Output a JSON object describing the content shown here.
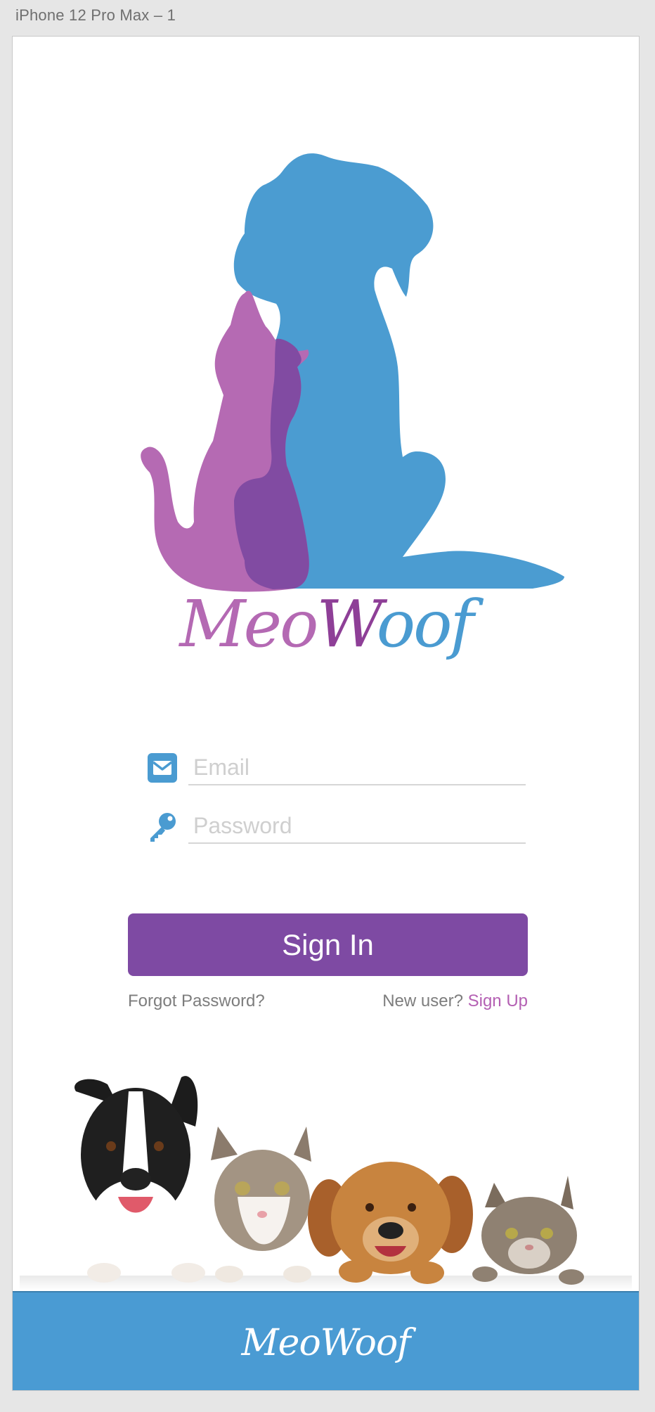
{
  "window": {
    "artboard_title": "iPhone 12 Pro Max – 1"
  },
  "brand": {
    "part1": "Meo",
    "part2": "W",
    "part3": "oof"
  },
  "form": {
    "email_placeholder": "Email",
    "password_placeholder": "Password",
    "sign_in_label": "Sign In"
  },
  "links": {
    "forgot_password": "Forgot Password?",
    "new_user": "New user?",
    "sign_up": "Sign Up"
  },
  "footer": {
    "title": "MeoWoof"
  },
  "colors": {
    "purple": "#7e4aa3",
    "pink": "#b469b3",
    "blue": "#4a9bd1"
  },
  "icons": {
    "email": "envelope-icon",
    "password": "key-icon"
  }
}
